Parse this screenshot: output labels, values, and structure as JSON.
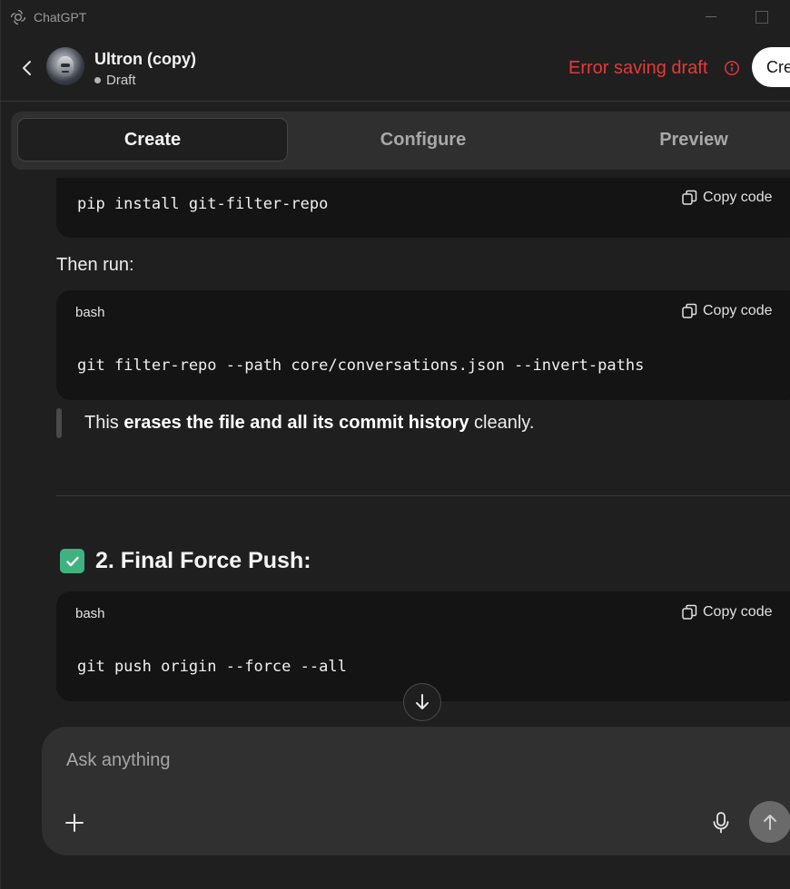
{
  "window": {
    "title": "ChatGPT"
  },
  "header": {
    "gpt_name": "Ultron (copy)",
    "status": "Draft",
    "error_text": "Error saving draft",
    "create_button": "Cre"
  },
  "tabs": [
    {
      "label": "Create",
      "active": true
    },
    {
      "label": "Configure",
      "active": false
    },
    {
      "label": "Preview",
      "active": false
    }
  ],
  "message": {
    "code_blocks": [
      {
        "lang": "",
        "copy_label": "Copy code",
        "code": "pip install git-filter-repo"
      },
      {
        "lang": "bash",
        "copy_label": "Copy code",
        "code": "git filter-repo --path core/conversations.json --invert-paths"
      },
      {
        "lang": "bash",
        "copy_label": "Copy code",
        "code": "git push origin --force --all"
      }
    ],
    "then_run": "Then run:",
    "quote": {
      "pre": "This ",
      "bold": "erases the file and all its commit history",
      "post": " cleanly."
    },
    "heading": "2. Final Force Push:"
  },
  "composer": {
    "placeholder": "Ask anything"
  },
  "colors": {
    "error": "#e5393a",
    "check": "#3fb27f",
    "background": "#1f1f1f"
  },
  "icons": [
    "openai-logo-icon",
    "back-chevron-icon",
    "info-icon",
    "copy-icon",
    "check-box-icon",
    "arrow-down-icon",
    "plus-icon",
    "microphone-icon",
    "arrow-up-icon"
  ]
}
